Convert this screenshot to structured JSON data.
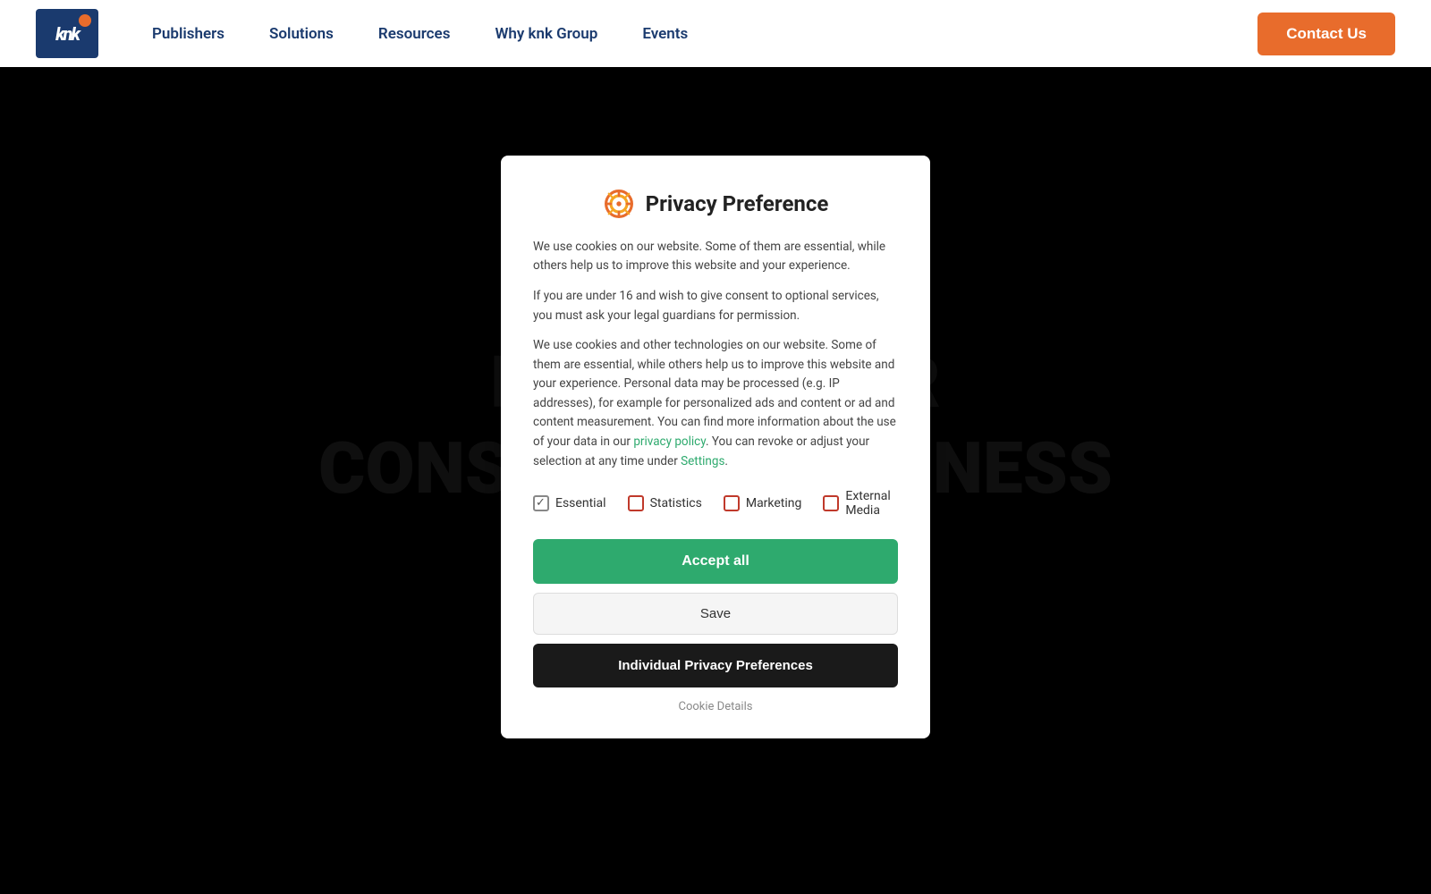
{
  "header": {
    "logo_text": "knk",
    "nav_items": [
      {
        "label": "Publishers",
        "id": "nav-publishers"
      },
      {
        "label": "Solutions",
        "id": "nav-solutions"
      },
      {
        "label": "Resources",
        "id": "nav-resources"
      },
      {
        "label": "Why knk Group",
        "id": "nav-why-knk"
      },
      {
        "label": "Events",
        "id": "nav-events"
      }
    ],
    "contact_button": "Contact Us"
  },
  "background": {
    "text_line1": "POWER YOUR",
    "text_line2": "CONSULTING BUSINESS"
  },
  "modal": {
    "title": "Privacy Preference",
    "para1": "We use cookies on our website. Some of them are essential, while others help us to improve this website and your experience.",
    "para2": "If you are under 16 and wish to give consent to optional services, you must ask your legal guardians for permission.",
    "para3_pre": "We use cookies and other technologies on our website. Some of them are essential, while others help us to improve this website and your experience. Personal data may be processed (e.g. IP addresses), for example for personalized ads and content or ad and content measurement. You can find more information about the use of your data in our ",
    "privacy_policy_link": "privacy policy",
    "para3_post": ". You can revoke or adjust your selection at any time under ",
    "settings_link": "Settings",
    "para3_end": ".",
    "cookie_options": [
      {
        "label": "Essential",
        "checked": true,
        "disabled": true,
        "id": "opt-essential"
      },
      {
        "label": "Statistics",
        "checked": false,
        "id": "opt-statistics"
      },
      {
        "label": "Marketing",
        "checked": false,
        "id": "opt-marketing"
      },
      {
        "label": "External Media",
        "checked": false,
        "id": "opt-external"
      }
    ],
    "btn_accept": "Accept all",
    "btn_save": "Save",
    "btn_individual": "Individual Privacy Preferences",
    "cookie_details": "Cookie Details"
  },
  "colors": {
    "accept_green": "#2eaa6e",
    "contact_orange": "#e86c2c",
    "nav_blue": "#1a3a6e",
    "modal_dark": "#1a1a1a"
  }
}
